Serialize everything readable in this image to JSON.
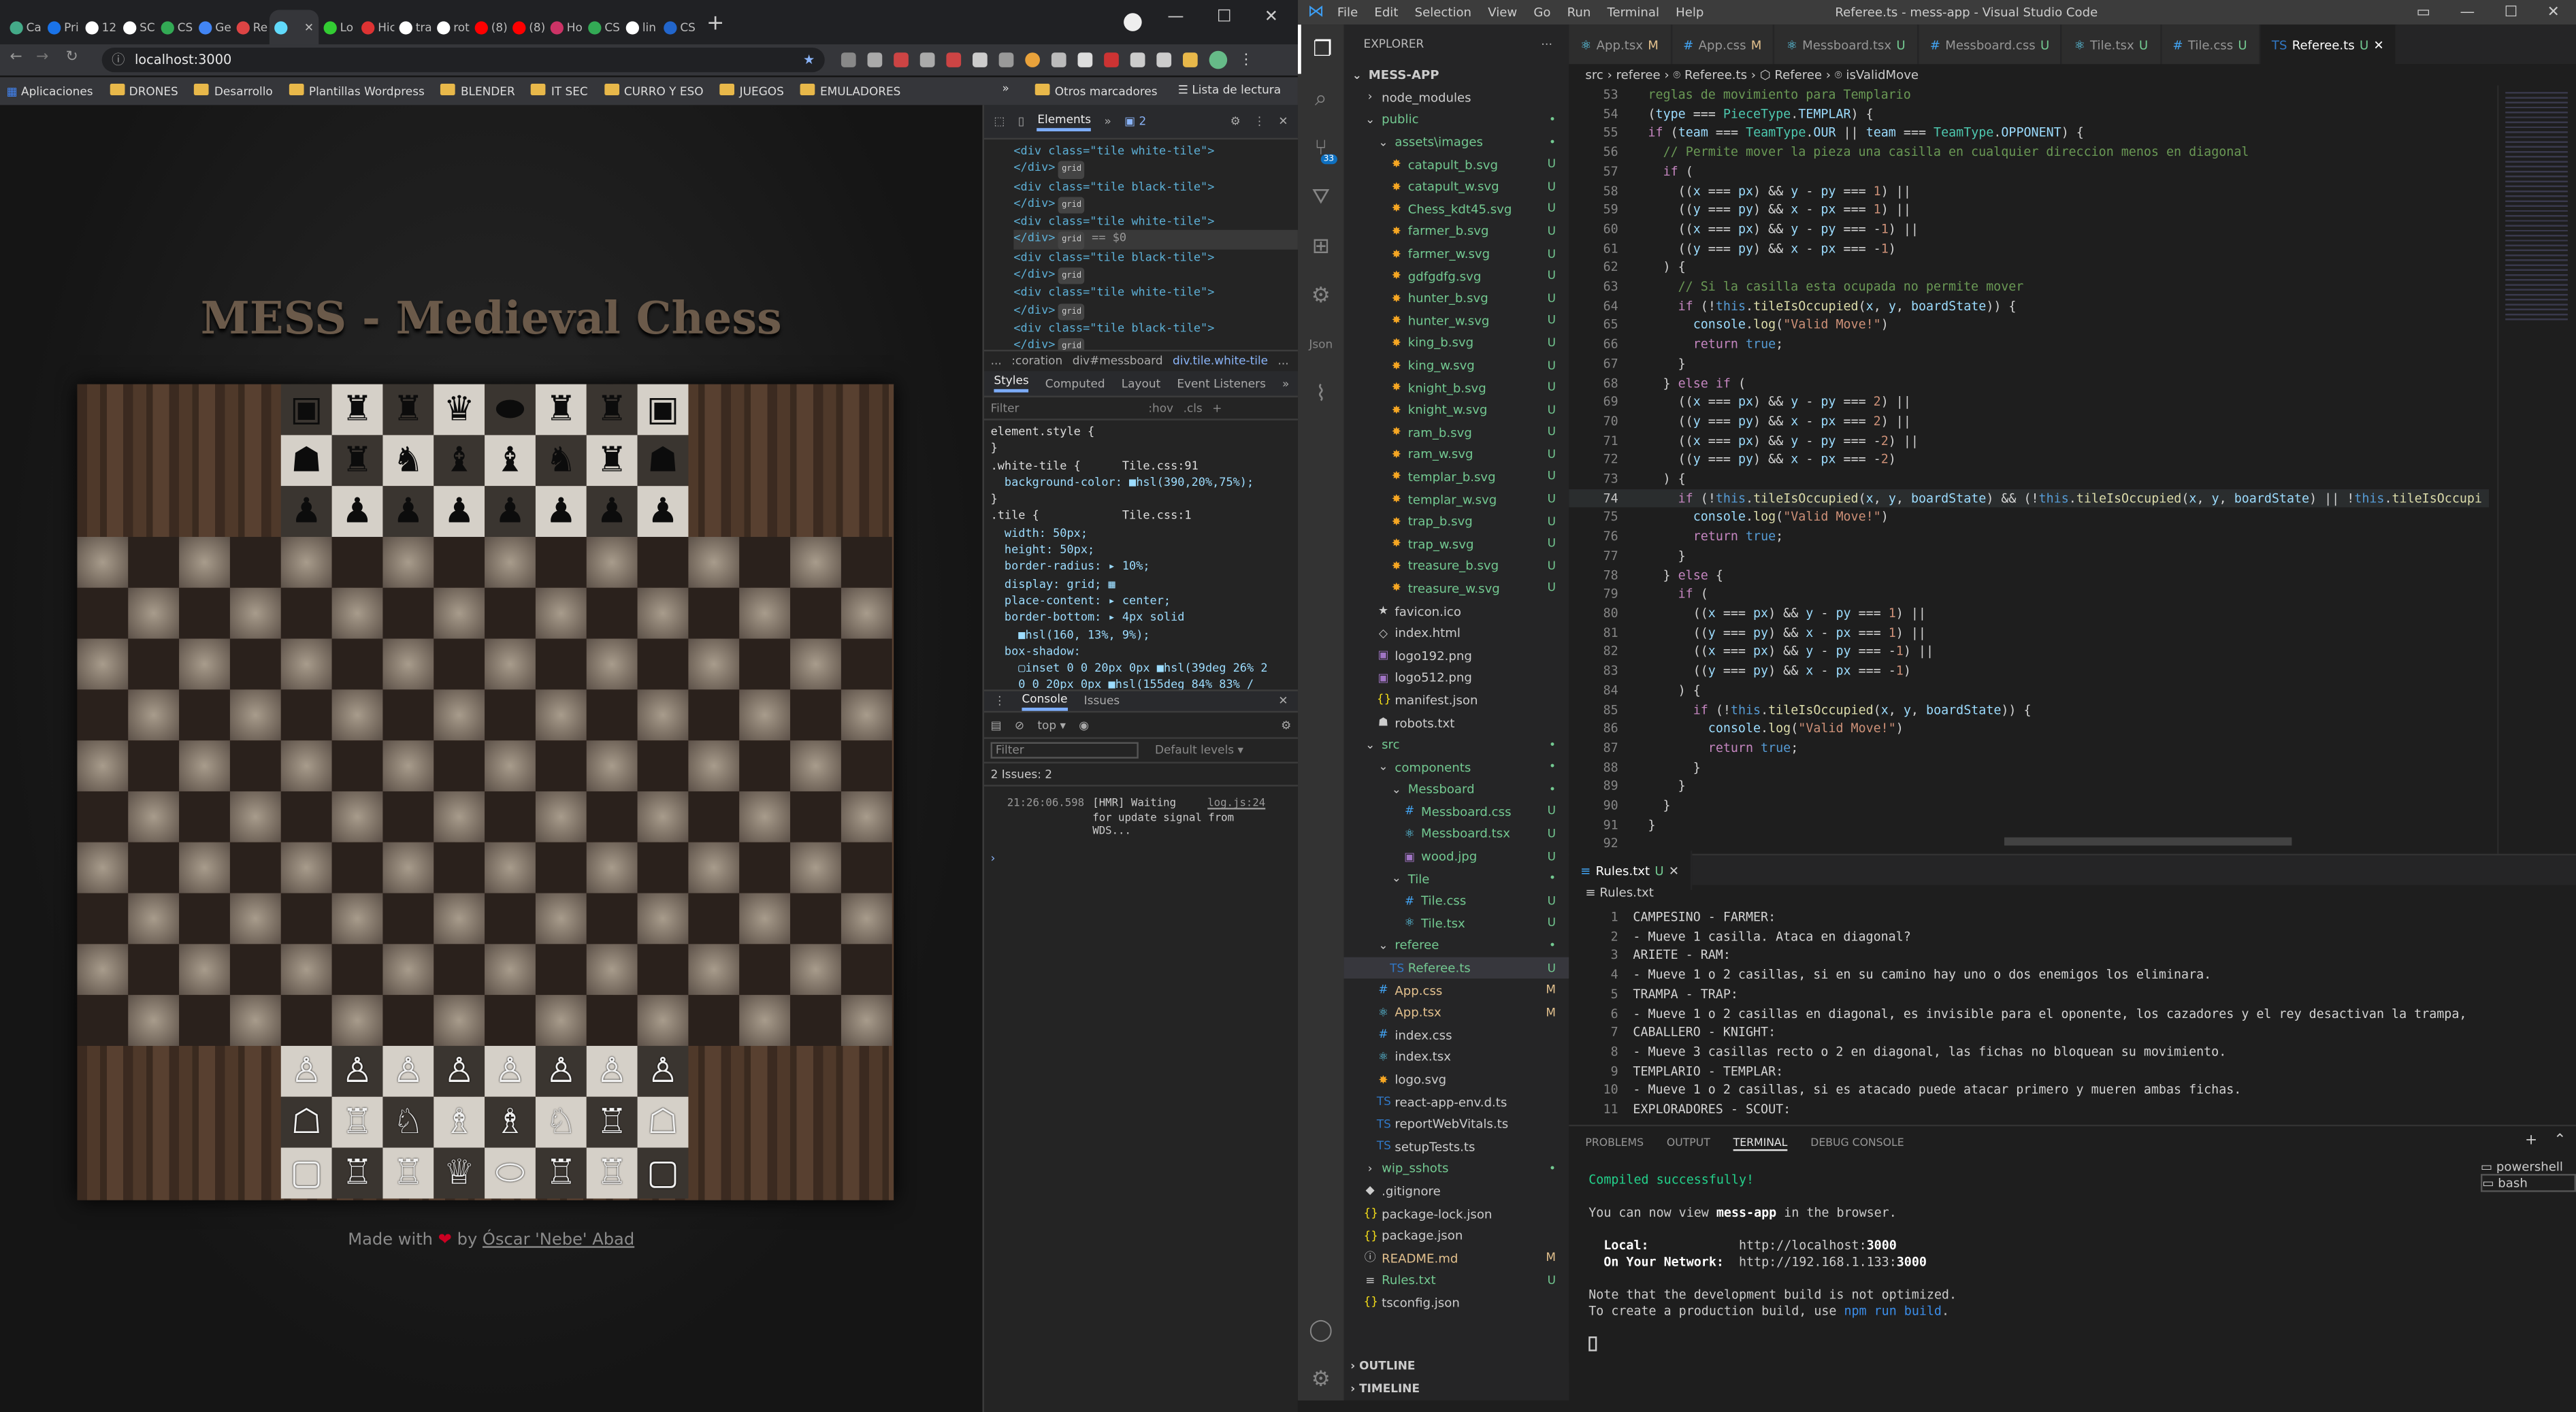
{
  "browser": {
    "tabs": [
      {
        "label": "Ca",
        "color": "#4a8"
      },
      {
        "label": "Pri",
        "color": "#1a73e8"
      },
      {
        "label": "12",
        "color": "#fff"
      },
      {
        "label": "SC",
        "color": "#fff"
      },
      {
        "label": "CS",
        "color": "#3a5"
      },
      {
        "label": "Ge",
        "color": "#4285f4"
      },
      {
        "label": "Re",
        "color": "#d44"
      },
      {
        "label": "",
        "color": "#61dafb"
      },
      {
        "label": "Lo",
        "color": "#3c3"
      },
      {
        "label": "Hic",
        "color": "#d33"
      },
      {
        "label": "tra",
        "color": "#fff"
      },
      {
        "label": "rot",
        "color": "#fff"
      },
      {
        "label": "(8)",
        "color": "#f00"
      },
      {
        "label": "(8)",
        "color": "#f00"
      },
      {
        "label": "Ho",
        "color": "#c36"
      },
      {
        "label": "CS",
        "color": "#3a5"
      },
      {
        "label": "lin",
        "color": "#fff"
      },
      {
        "label": "CS",
        "color": "#26c"
      }
    ],
    "new_tab": "+",
    "url": "localhost:3000",
    "bookmarks": [
      "Aplicaciones",
      "DRONES",
      "Desarrollo",
      "Plantillas Wordpress",
      "BLENDER",
      "IT SEC",
      "CURRO Y ESO",
      "JUEGOS",
      "EMULADORES"
    ],
    "more_bookmarks": "»",
    "other_bookmarks": "Otros marcadores",
    "reading_list": "Lista de lectura"
  },
  "page": {
    "title": "MESS - Medieval Chess",
    "made_with": "Made with",
    "heart": "❤",
    "by": "by",
    "author": "Óscar 'Nebe' Abad",
    "pieces": {
      "top_back": [
        "▣",
        "♜",
        "♜",
        "♛",
        "⬬",
        "♜",
        "♜",
        "▣"
      ],
      "top_second": [
        "☗",
        "♜",
        "♞",
        "♝",
        "♝",
        "♞",
        "♜",
        "☗"
      ],
      "top_pawns": [
        "♟",
        "♟",
        "♟",
        "♟",
        "♟",
        "♟",
        "♟",
        "♟"
      ],
      "bottom_pawns": [
        "♙",
        "♙",
        "♙",
        "♙",
        "♙",
        "♙",
        "♙",
        "♙"
      ],
      "bottom_second": [
        "☖",
        "♖",
        "♘",
        "♗",
        "♗",
        "♘",
        "♖",
        "☖"
      ],
      "bottom_back": [
        "▢",
        "♖",
        "♖",
        "♕",
        "⬭",
        "♖",
        "♖",
        "▢"
      ]
    }
  },
  "devtools": {
    "tabs": [
      "Elements",
      "»",
      "2"
    ],
    "dom_lines": [
      {
        "t": "<div class=\"tile white-tile\">"
      },
      {
        "t": "</div>",
        "g": "grid"
      },
      {
        "t": "<div class=\"tile black-tile\">"
      },
      {
        "t": "</div>",
        "g": "grid"
      },
      {
        "t": "<div class=\"tile white-tile\">"
      },
      {
        "t": "</div>",
        "g": "grid",
        "s": " == $0"
      },
      {
        "t": "<div class=\"tile black-tile\">"
      },
      {
        "t": "</div>",
        "g": "grid"
      },
      {
        "t": "<div class=\"tile white-tile\">"
      },
      {
        "t": "</div>",
        "g": "grid"
      },
      {
        "t": "<div class=\"tile black-tile\">"
      },
      {
        "t": "</div>",
        "g": "grid"
      },
      {
        "t": "<div class=\"tile white-tile\">"
      }
    ],
    "crumbs": [
      "...",
      ":coration",
      "div#messboard",
      "div.tile.white-tile",
      "..."
    ],
    "style_tabs": [
      "Styles",
      "Computed",
      "Layout",
      "Event Listeners",
      "»"
    ],
    "filter": "Filter",
    "hov": ":hov",
    "cls": ".cls",
    "css_lines": [
      "element.style {",
      "}",
      ".white-tile {      Tile.css:91",
      "  background-color: ■hsl(390,20%,75%);",
      "}",
      ".tile {            Tile.css:1",
      "  width: 50px;",
      "  height: 50px;",
      "  border-radius: ▸ 10%;",
      "  display: grid; ▦",
      "  place-content: ▸ center;",
      "  border-bottom: ▸ 4px solid",
      "    ■hsl(160, 13%, 9%);",
      "  box-shadow:",
      "    ▢inset 0 0 20px 0px ■hsl(39deg 26% 2",
      "    0 0 20px 0px ■hsl(155deg 84% 83% /",
      "  transition: ▸ 1s ▦ease-in-out;"
    ],
    "console_tabs": [
      "Console",
      "Issues"
    ],
    "console_top": "top",
    "console_filter": "Filter",
    "levels": "Default levels ▾",
    "issues": "2 Issues:  2",
    "log_time": "21:26:06.598",
    "log_msg": "[HMR] Waiting\nfor update signal from\nWDS...",
    "log_src": "log.js:24",
    "prompt": "›"
  },
  "vscode": {
    "menu": [
      "File",
      "Edit",
      "Selection",
      "View",
      "Go",
      "Run",
      "Terminal",
      "Help"
    ],
    "title": "Referee.ts - mess-app - Visual Studio Code",
    "explorer_title": "EXPLORER",
    "tabs": [
      {
        "name": "App.tsx",
        "flag": "M"
      },
      {
        "name": "App.css",
        "flag": "M"
      },
      {
        "name": "Messboard.tsx",
        "flag": "U"
      },
      {
        "name": "Messboard.css",
        "flag": "U"
      },
      {
        "name": "Tile.tsx",
        "flag": "U"
      },
      {
        "name": "Tile.css",
        "flag": "U"
      },
      {
        "name": "Referee.ts",
        "flag": "U"
      }
    ],
    "breadcrumb": "src › referee › ⌾ Referee.ts › ⬡ Referee › ⌾ isValidMove",
    "tree": [
      {
        "d": 0,
        "n": "MESS-APP",
        "i": "⌄",
        "bold": true
      },
      {
        "d": 1,
        "n": "node_modules",
        "i": "›"
      },
      {
        "d": 1,
        "n": "public",
        "i": "⌄",
        "s": "•",
        "sc": "#73c991"
      },
      {
        "d": 2,
        "n": "assets\\images",
        "i": "⌄",
        "s": "•",
        "sc": "#73c991"
      },
      {
        "d": 3,
        "n": "catapult_b.svg",
        "i": "✸",
        "s": "U",
        "sc": "#73c991"
      },
      {
        "d": 3,
        "n": "catapult_w.svg",
        "i": "✸",
        "s": "U",
        "sc": "#73c991"
      },
      {
        "d": 3,
        "n": "Chess_kdt45.svg",
        "i": "✸",
        "s": "U",
        "sc": "#73c991"
      },
      {
        "d": 3,
        "n": "farmer_b.svg",
        "i": "✸",
        "s": "U",
        "sc": "#73c991"
      },
      {
        "d": 3,
        "n": "farmer_w.svg",
        "i": "✸",
        "s": "U",
        "sc": "#73c991"
      },
      {
        "d": 3,
        "n": "gdfgdfg.svg",
        "i": "✸",
        "s": "U",
        "sc": "#73c991"
      },
      {
        "d": 3,
        "n": "hunter_b.svg",
        "i": "✸",
        "s": "U",
        "sc": "#73c991"
      },
      {
        "d": 3,
        "n": "hunter_w.svg",
        "i": "✸",
        "s": "U",
        "sc": "#73c991"
      },
      {
        "d": 3,
        "n": "king_b.svg",
        "i": "✸",
        "s": "U",
        "sc": "#73c991"
      },
      {
        "d": 3,
        "n": "king_w.svg",
        "i": "✸",
        "s": "U",
        "sc": "#73c991"
      },
      {
        "d": 3,
        "n": "knight_b.svg",
        "i": "✸",
        "s": "U",
        "sc": "#73c991"
      },
      {
        "d": 3,
        "n": "knight_w.svg",
        "i": "✸",
        "s": "U",
        "sc": "#73c991"
      },
      {
        "d": 3,
        "n": "ram_b.svg",
        "i": "✸",
        "s": "U",
        "sc": "#73c991"
      },
      {
        "d": 3,
        "n": "ram_w.svg",
        "i": "✸",
        "s": "U",
        "sc": "#73c991"
      },
      {
        "d": 3,
        "n": "templar_b.svg",
        "i": "✸",
        "s": "U",
        "sc": "#73c991"
      },
      {
        "d": 3,
        "n": "templar_w.svg",
        "i": "✸",
        "s": "U",
        "sc": "#73c991"
      },
      {
        "d": 3,
        "n": "trap_b.svg",
        "i": "✸",
        "s": "U",
        "sc": "#73c991"
      },
      {
        "d": 3,
        "n": "trap_w.svg",
        "i": "✸",
        "s": "U",
        "sc": "#73c991"
      },
      {
        "d": 3,
        "n": "treasure_b.svg",
        "i": "✸",
        "s": "U",
        "sc": "#73c991"
      },
      {
        "d": 3,
        "n": "treasure_w.svg",
        "i": "✸",
        "s": "U",
        "sc": "#73c991"
      },
      {
        "d": 2,
        "n": "favicon.ico",
        "i": "★"
      },
      {
        "d": 2,
        "n": "index.html",
        "i": "◇"
      },
      {
        "d": 2,
        "n": "logo192.png",
        "i": "▣"
      },
      {
        "d": 2,
        "n": "logo512.png",
        "i": "▣"
      },
      {
        "d": 2,
        "n": "manifest.json",
        "i": "{}"
      },
      {
        "d": 2,
        "n": "robots.txt",
        "i": "☗"
      },
      {
        "d": 1,
        "n": "src",
        "i": "⌄",
        "s": "•",
        "sc": "#73c991"
      },
      {
        "d": 2,
        "n": "components",
        "i": "⌄",
        "s": "•",
        "sc": "#73c991"
      },
      {
        "d": 3,
        "n": "Messboard",
        "i": "⌄",
        "s": "•",
        "sc": "#73c991"
      },
      {
        "d": 4,
        "n": "Messboard.css",
        "i": "#",
        "s": "U",
        "sc": "#73c991"
      },
      {
        "d": 4,
        "n": "Messboard.tsx",
        "i": "⚛",
        "s": "U",
        "sc": "#73c991"
      },
      {
        "d": 4,
        "n": "wood.jpg",
        "i": "▣",
        "s": "U",
        "sc": "#73c991"
      },
      {
        "d": 3,
        "n": "Tile",
        "i": "⌄",
        "s": "•",
        "sc": "#73c991"
      },
      {
        "d": 4,
        "n": "Tile.css",
        "i": "#",
        "s": "U",
        "sc": "#73c991"
      },
      {
        "d": 4,
        "n": "Tile.tsx",
        "i": "⚛",
        "s": "U",
        "sc": "#73c991"
      },
      {
        "d": 2,
        "n": "referee",
        "i": "⌄",
        "s": "•",
        "sc": "#73c991"
      },
      {
        "d": 3,
        "n": "Referee.ts",
        "i": "TS",
        "s": "U",
        "sc": "#73c991",
        "sel": true
      },
      {
        "d": 2,
        "n": "App.css",
        "i": "#",
        "s": "M",
        "sc": "#e2c08d"
      },
      {
        "d": 2,
        "n": "App.tsx",
        "i": "⚛",
        "s": "M",
        "sc": "#e2c08d"
      },
      {
        "d": 2,
        "n": "index.css",
        "i": "#"
      },
      {
        "d": 2,
        "n": "index.tsx",
        "i": "⚛"
      },
      {
        "d": 2,
        "n": "logo.svg",
        "i": "✸"
      },
      {
        "d": 2,
        "n": "react-app-env.d.ts",
        "i": "TS"
      },
      {
        "d": 2,
        "n": "reportWebVitals.ts",
        "i": "TS"
      },
      {
        "d": 2,
        "n": "setupTests.ts",
        "i": "TS"
      },
      {
        "d": 1,
        "n": "wip_sshots",
        "i": "›",
        "s": "•",
        "sc": "#73c991"
      },
      {
        "d": 1,
        "n": ".gitignore",
        "i": "◆"
      },
      {
        "d": 1,
        "n": "package-lock.json",
        "i": "{}"
      },
      {
        "d": 1,
        "n": "package.json",
        "i": "{}"
      },
      {
        "d": 1,
        "n": "README.md",
        "i": "ⓘ",
        "s": "M",
        "sc": "#e2c08d"
      },
      {
        "d": 1,
        "n": "Rules.txt",
        "i": "≡",
        "s": "U",
        "sc": "#73c991"
      },
      {
        "d": 1,
        "n": "tsconfig.json",
        "i": "{}"
      }
    ],
    "outline": "OUTLINE",
    "timeline": "TIMELINE",
    "code_lines": [
      {
        "n": "53",
        "h": "<span class='cm'>  reglas de movimiento para Templario</span>"
      },
      {
        "n": "54",
        "h": "  (<span class='vr'>type</span> === <span class='ty'>PieceType</span>.<span class='vr'>TEMPLAR</span>) {"
      },
      {
        "n": "55",
        "h": "  <span class='kw'>if</span> (<span class='vr'>team</span> === <span class='ty'>TeamType</span>.<span class='vr'>OUR</span> || <span class='vr'>team</span> === <span class='ty'>TeamType</span>.<span class='vr'>OPPONENT</span>) {"
      },
      {
        "n": "56",
        "h": "    <span class='cm'>// Permite mover la pieza una casilla en cualquier direccion menos en diagonal</span>"
      },
      {
        "n": "57",
        "h": "    <span class='kw'>if</span> ("
      },
      {
        "n": "58",
        "h": "      ((<span class='vr'>x</span> === <span class='vr'>px</span>) &amp;&amp; <span class='vr'>y</span> - <span class='vr'>py</span> === <span class='st2'>1</span>) ||"
      },
      {
        "n": "59",
        "h": "      ((<span class='vr'>y</span> === <span class='vr'>py</span>) &amp;&amp; <span class='vr'>x</span> - <span class='vr'>px</span> === <span class='st2'>1</span>) ||"
      },
      {
        "n": "60",
        "h": "      ((<span class='vr'>x</span> === <span class='vr'>px</span>) &amp;&amp; <span class='vr'>y</span> - <span class='vr'>py</span> === -<span class='st2'>1</span>) ||"
      },
      {
        "n": "61",
        "h": "      ((<span class='vr'>y</span> === <span class='vr'>py</span>) &amp;&amp; <span class='vr'>x</span> - <span class='vr'>px</span> === -<span class='st2'>1</span>)"
      },
      {
        "n": "62",
        "h": "    ) {"
      },
      {
        "n": "63",
        "h": "      <span class='cm'>// Si la casilla esta ocupada no permite mover</span>"
      },
      {
        "n": "64",
        "h": "      <span class='kw'>if</span> (!<span class='kb'>this</span>.<span class='fn'>tileIsOccupied</span>(<span class='vr'>x</span>, <span class='vr'>y</span>, <span class='vr'>boardState</span>)) {"
      },
      {
        "n": "65",
        "h": "        <span class='vr'>console</span>.<span class='fn'>log</span>(<span class='st2'>\"Valid Move!\"</span>)"
      },
      {
        "n": "66",
        "h": "        <span class='kw'>return</span> <span class='kb'>true</span>;"
      },
      {
        "n": "67",
        "h": "      }"
      },
      {
        "n": "68",
        "h": "    } <span class='kw'>else if</span> ("
      },
      {
        "n": "69",
        "h": "      ((<span class='vr'>x</span> === <span class='vr'>px</span>) &amp;&amp; <span class='vr'>y</span> - <span class='vr'>py</span> === <span class='st2'>2</span>) ||"
      },
      {
        "n": "70",
        "h": "      ((<span class='vr'>y</span> === <span class='vr'>py</span>) &amp;&amp; <span class='vr'>x</span> - <span class='vr'>px</span> === <span class='st2'>2</span>) ||"
      },
      {
        "n": "71",
        "h": "      ((<span class='vr'>x</span> === <span class='vr'>px</span>) &amp;&amp; <span class='vr'>y</span> - <span class='vr'>py</span> === -<span class='st2'>2</span>) ||"
      },
      {
        "n": "72",
        "h": "      ((<span class='vr'>y</span> === <span class='vr'>py</span>) &amp;&amp; <span class='vr'>x</span> - <span class='vr'>px</span> === -<span class='st2'>2</span>)"
      },
      {
        "n": "73",
        "h": "    ) {"
      },
      {
        "n": "74",
        "h": "      <span class='kw'>if</span> (!<span class='kb'>this</span>.<span class='fn'>tileIsOccupied</span>(<span class='vr'>x</span>, <span class='vr'>y</span>, <span class='vr'>boardState</span>) &amp;&amp; (!<span class='kb'>this</span>.<span class='fn'>tileIsOccupied</span>(<span class='vr'>x</span>, <span class='vr'>y</span>, <span class='vr'>boardState</span>) || !<span class='kb'>this</span>.<span class='fn'>tileIsOccupi</span>",
        "cur": true
      },
      {
        "n": "75",
        "h": "        <span class='vr'>console</span>.<span class='fn'>log</span>(<span class='st2'>\"Valid Move!\"</span>)"
      },
      {
        "n": "76",
        "h": "        <span class='kw'>return</span> <span class='kb'>true</span>;"
      },
      {
        "n": "77",
        "h": "      }"
      },
      {
        "n": "78",
        "h": "    } <span class='kw'>else</span> {"
      },
      {
        "n": "79",
        "h": "      <span class='kw'>if</span> ("
      },
      {
        "n": "80",
        "h": "        ((<span class='vr'>x</span> === <span class='vr'>px</span>) &amp;&amp; <span class='vr'>y</span> - <span class='vr'>py</span> === <span class='st2'>1</span>) ||"
      },
      {
        "n": "81",
        "h": "        ((<span class='vr'>y</span> === <span class='vr'>py</span>) &amp;&amp; <span class='vr'>x</span> - <span class='vr'>px</span> === <span class='st2'>1</span>) ||"
      },
      {
        "n": "82",
        "h": "        ((<span class='vr'>x</span> === <span class='vr'>px</span>) &amp;&amp; <span class='vr'>y</span> - <span class='vr'>py</span> === -<span class='st2'>1</span>) ||"
      },
      {
        "n": "83",
        "h": "        ((<span class='vr'>y</span> === <span class='vr'>py</span>) &amp;&amp; <span class='vr'>x</span> - <span class='vr'>px</span> === -<span class='st2'>1</span>)"
      },
      {
        "n": "84",
        "h": "      ) {"
      },
      {
        "n": "85",
        "h": "        <span class='kw'>if</span> (!<span class='kb'>this</span>.<span class='fn'>tileIsOccupied</span>(<span class='vr'>x</span>, <span class='vr'>y</span>, <span class='vr'>boardState</span>)) {"
      },
      {
        "n": "86",
        "h": "          <span class='vr'>console</span>.<span class='fn'>log</span>(<span class='st2'>\"Valid Move!\"</span>)"
      },
      {
        "n": "87",
        "h": "          <span class='kw'>return</span> <span class='kb'>true</span>;"
      },
      {
        "n": "88",
        "h": "        }"
      },
      {
        "n": "89",
        "h": "      }"
      },
      {
        "n": "90",
        "h": "    }"
      },
      {
        "n": "91",
        "h": "  }"
      },
      {
        "n": "92",
        "h": ""
      }
    ],
    "rules_tab": "Rules.txt",
    "rules_flag": "U",
    "rules_crumb": "Rules.txt",
    "rules_lines": [
      {
        "n": "1",
        "t": "CAMPESINO - FARMER:"
      },
      {
        "n": "2",
        "t": "- Mueve 1 casilla. Ataca en diagonal?"
      },
      {
        "n": "3",
        "t": "ARIETE - RAM:"
      },
      {
        "n": "4",
        "t": "- Mueve 1 o 2 casillas, si en su camino hay uno o dos enemigos los eliminara."
      },
      {
        "n": "5",
        "t": "TRAMPA - TRAP:"
      },
      {
        "n": "6",
        "t": "- Mueve 1 o 2 casillas en diagonal, es invisible para el oponente, los cazadores y el rey desactivan la trampa,"
      },
      {
        "n": "7",
        "t": "CABALLERO - KNIGHT:"
      },
      {
        "n": "8",
        "t": "- Mueve 3 casillas recto o 2 en diagonal, las fichas no bloquean su movimiento."
      },
      {
        "n": "9",
        "t": "TEMPLARIO - TEMPLAR:"
      },
      {
        "n": "10",
        "t": "- Mueve 1 o 2 casillas, si es atacado puede atacar primero y mueren ambas fichas."
      },
      {
        "n": "11",
        "t": "EXPLORADORES - SCOUT:"
      }
    ],
    "panel_tabs": [
      "PROBLEMS",
      "OUTPUT",
      "TERMINAL",
      "DEBUG CONSOLE"
    ],
    "terminal": {
      "compiled": "Compiled successfully!",
      "view_pre": "You can now view ",
      "app": "mess-app",
      "view_post": " in the browser.",
      "local_label": "  Local:",
      "local_url": "http://localhost:",
      "local_port": "3000",
      "net_label": "  On Your Network:",
      "net_url": "http://192.168.1.133:",
      "net_port": "3000",
      "note": "Note that the development build is not optimized.",
      "prod_pre": "To create a production build, use ",
      "prod_cmd": "npm run build",
      "prod_post": "."
    },
    "shells": [
      "powershell",
      "bash"
    ]
  }
}
